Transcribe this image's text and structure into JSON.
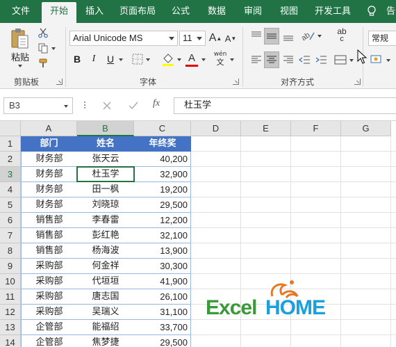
{
  "ribbon_tabs": [
    "文件",
    "开始",
    "插入",
    "页面布局",
    "公式",
    "数据",
    "审阅",
    "视图",
    "开发工具"
  ],
  "tell_me": "告",
  "clipboard": {
    "paste_label": "粘贴",
    "group_label": "剪贴板"
  },
  "font": {
    "name": "Arial Unicode MS",
    "size": "11",
    "grow_glyph": "A",
    "shrink_glyph": "A",
    "bold": "B",
    "italic": "I",
    "underline": "U",
    "phonetic": "wén",
    "phonetic_sub": "文",
    "font_color_glyph": "A",
    "group_label": "字体"
  },
  "alignment": {
    "group_label": "对齐方式",
    "wrap_glyph": "ab",
    "wrap_sub": "c"
  },
  "number": {
    "format": "常规"
  },
  "namebox": {
    "value": "B3"
  },
  "formula": {
    "fx": "fx",
    "value": "杜玉学"
  },
  "columns": [
    "A",
    "B",
    "C",
    "D",
    "E",
    "F",
    "G"
  ],
  "rows": [
    "1",
    "2",
    "3",
    "4",
    "5",
    "6",
    "7",
    "8",
    "9",
    "10",
    "11",
    "12",
    "13",
    "14"
  ],
  "table": {
    "headers": [
      "部门",
      "姓名",
      "年终奖"
    ],
    "rows": [
      [
        "财务部",
        "张天云",
        "40,200"
      ],
      [
        "财务部",
        "杜玉学",
        "32,900"
      ],
      [
        "财务部",
        "田一枫",
        "19,200"
      ],
      [
        "财务部",
        "刘晓琼",
        "29,500"
      ],
      [
        "销售部",
        "李春雷",
        "12,200"
      ],
      [
        "销售部",
        "彭红艳",
        "32,100"
      ],
      [
        "销售部",
        "杨海波",
        "13,900"
      ],
      [
        "采购部",
        "何金祥",
        "30,300"
      ],
      [
        "采购部",
        "代垣垣",
        "41,900"
      ],
      [
        "采购部",
        "唐志国",
        "26,100"
      ],
      [
        "采购部",
        "吴瑞义",
        "31,100"
      ],
      [
        "企管部",
        "能福绍",
        "33,700"
      ],
      [
        "企管部",
        "焦梦捷",
        "29,500"
      ]
    ]
  },
  "logo": {
    "part1": "Excel",
    "part2": "HOME"
  },
  "colors": {
    "excel_green": "#217346",
    "header_blue": "#4472c4",
    "logo_green": "#3a9a3a",
    "logo_blue": "#1aa0dc",
    "logo_orange": "#e87722"
  },
  "icons": [
    "lightbulb-icon",
    "paste-icon",
    "cut-icon",
    "copy-icon",
    "format-painter-icon",
    "borders-icon",
    "fill-color-icon",
    "align-top-icon",
    "align-middle-icon",
    "align-bottom-icon",
    "orientation-icon",
    "wrap-text-icon",
    "align-left-icon",
    "align-center-icon",
    "align-right-icon",
    "decrease-indent-icon",
    "increase-indent-icon",
    "merge-center-icon",
    "cancel-icon",
    "enter-icon",
    "mouse-cursor-icon"
  ]
}
